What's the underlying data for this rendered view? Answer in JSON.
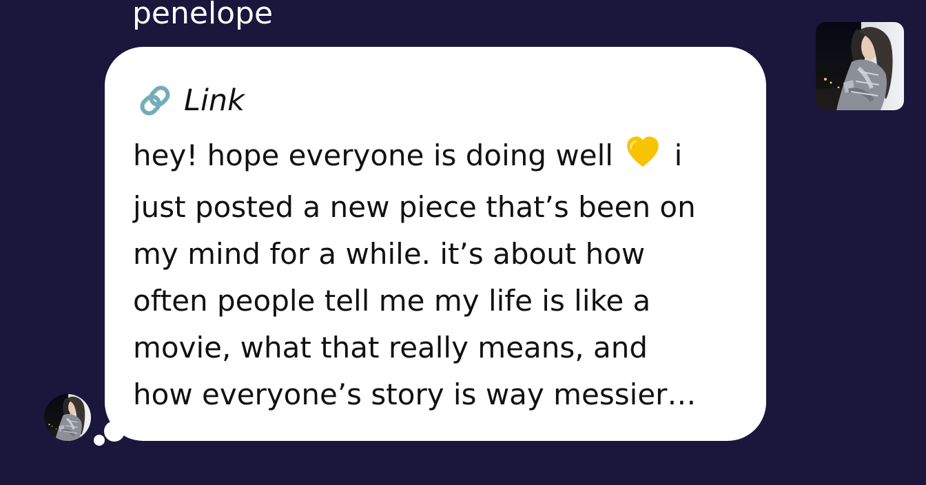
{
  "message": {
    "sender_name": "penelope",
    "link_label": "Link",
    "body_lines": [
      "hey! hope everyone is doing well",
      "i",
      "just posted a new piece that’s been on",
      "my mind for a while. it’s about how",
      "often people tell me my life is like a",
      "movie, what that really means, and",
      "how everyone’s story is way messier…"
    ]
  },
  "icons": {
    "link": "link-icon",
    "heart": "yellow-heart-icon",
    "avatar": "avatar"
  },
  "colors": {
    "background": "#1b163c",
    "bubble": "#ffffff",
    "text": "#111111",
    "sender_name": "#ffffff",
    "heart": "#f6c400"
  }
}
